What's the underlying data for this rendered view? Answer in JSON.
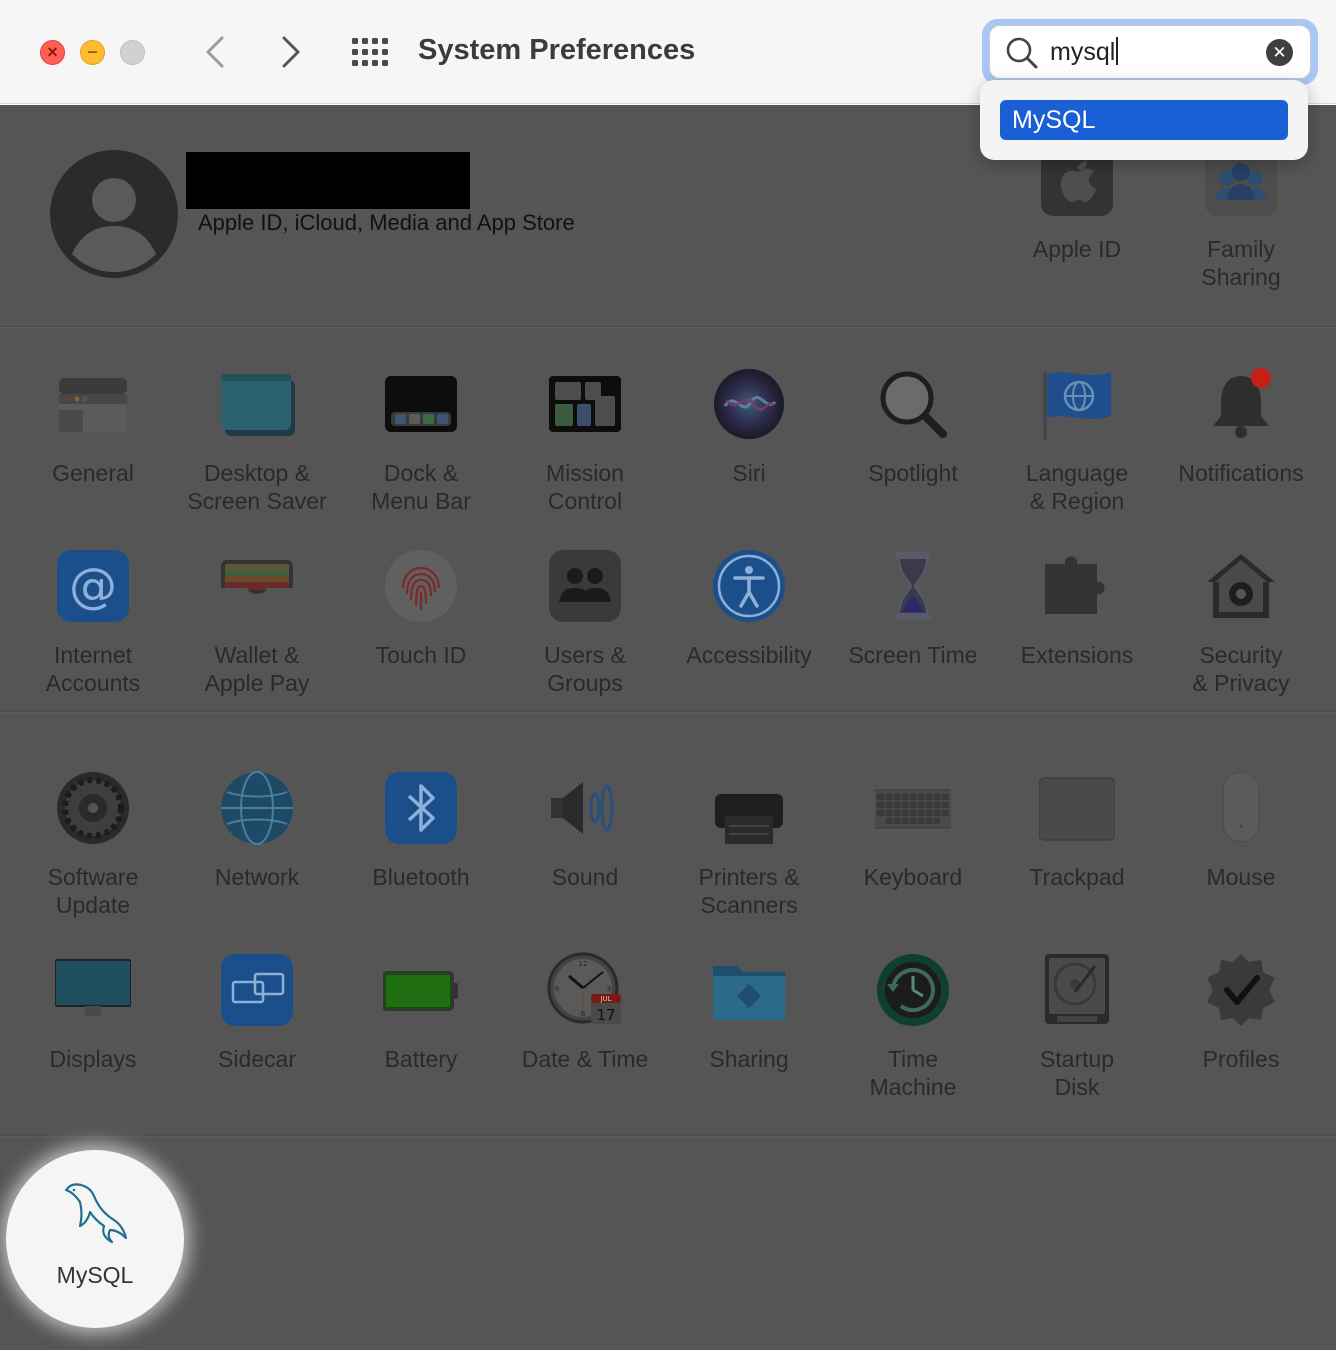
{
  "window": {
    "title": "System Preferences"
  },
  "search": {
    "query": "mysql",
    "results": [
      "MySQL"
    ]
  },
  "account": {
    "subtitle": "Apple ID, iCloud, Media and App Store"
  },
  "top_panes": [
    {
      "name": "apple-id",
      "l1": "Apple ID",
      "l2": ""
    },
    {
      "name": "family-sharing",
      "l1": "Family",
      "l2": "Sharing"
    }
  ],
  "panes": [
    {
      "name": "general",
      "l1": "General",
      "l2": ""
    },
    {
      "name": "desktop-screen-saver",
      "l1": "Desktop &",
      "l2": "Screen Saver"
    },
    {
      "name": "dock-menu-bar",
      "l1": "Dock &",
      "l2": "Menu Bar"
    },
    {
      "name": "mission-control",
      "l1": "Mission",
      "l2": "Control"
    },
    {
      "name": "siri",
      "l1": "Siri",
      "l2": ""
    },
    {
      "name": "spotlight",
      "l1": "Spotlight",
      "l2": ""
    },
    {
      "name": "language-region",
      "l1": "Language",
      "l2": "& Region"
    },
    {
      "name": "notifications",
      "l1": "Notifications",
      "l2": ""
    },
    {
      "name": "internet-accounts",
      "l1": "Internet",
      "l2": "Accounts"
    },
    {
      "name": "wallet-apple-pay",
      "l1": "Wallet &",
      "l2": "Apple Pay"
    },
    {
      "name": "touch-id",
      "l1": "Touch ID",
      "l2": ""
    },
    {
      "name": "users-groups",
      "l1": "Users &",
      "l2": "Groups"
    },
    {
      "name": "accessibility",
      "l1": "Accessibility",
      "l2": ""
    },
    {
      "name": "screen-time",
      "l1": "Screen Time",
      "l2": ""
    },
    {
      "name": "extensions",
      "l1": "Extensions",
      "l2": ""
    },
    {
      "name": "security-privacy",
      "l1": "Security",
      "l2": "& Privacy"
    },
    {
      "name": "software-update",
      "l1": "Software",
      "l2": "Update"
    },
    {
      "name": "network",
      "l1": "Network",
      "l2": ""
    },
    {
      "name": "bluetooth",
      "l1": "Bluetooth",
      "l2": ""
    },
    {
      "name": "sound",
      "l1": "Sound",
      "l2": ""
    },
    {
      "name": "printers-scanners",
      "l1": "Printers &",
      "l2": "Scanners"
    },
    {
      "name": "keyboard",
      "l1": "Keyboard",
      "l2": ""
    },
    {
      "name": "trackpad",
      "l1": "Trackpad",
      "l2": ""
    },
    {
      "name": "mouse",
      "l1": "Mouse",
      "l2": ""
    },
    {
      "name": "displays",
      "l1": "Displays",
      "l2": ""
    },
    {
      "name": "sidecar",
      "l1": "Sidecar",
      "l2": ""
    },
    {
      "name": "battery",
      "l1": "Battery",
      "l2": ""
    },
    {
      "name": "date-time",
      "l1": "Date & Time",
      "l2": ""
    },
    {
      "name": "sharing",
      "l1": "Sharing",
      "l2": ""
    },
    {
      "name": "time-machine",
      "l1": "Time",
      "l2": "Machine"
    },
    {
      "name": "startup-disk",
      "l1": "Startup",
      "l2": "Disk"
    },
    {
      "name": "profiles",
      "l1": "Profiles",
      "l2": ""
    }
  ],
  "third_party": {
    "label": "MySQL"
  },
  "date_icon": {
    "month": "JUL",
    "day": "17",
    "clock_12": "12",
    "clock_3": "3",
    "clock_6": "6",
    "clock_9": "9"
  },
  "colors": {
    "dim_overlay": "#555555",
    "selection": "#1a5fd6",
    "search_ring": "#a9c6f4"
  }
}
